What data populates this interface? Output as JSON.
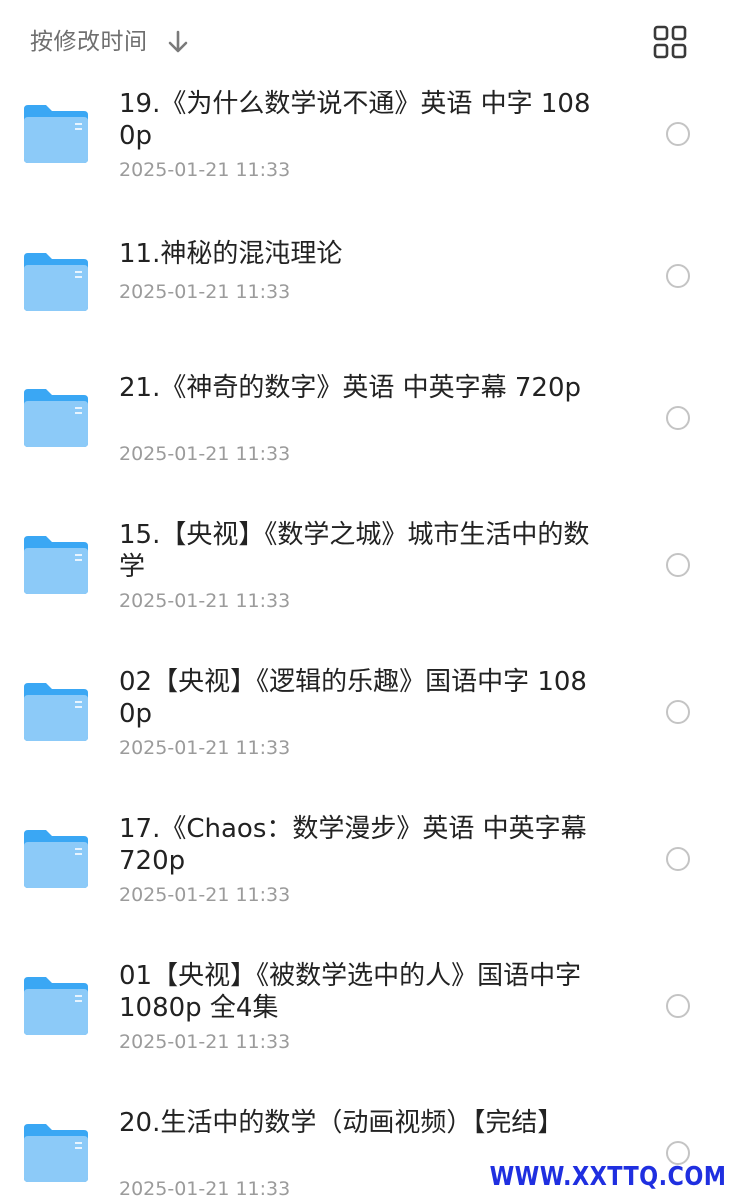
{
  "sort_bar": {
    "label": "按修改时间",
    "arrow_icon": "arrow-down-icon",
    "view_toggle_icon": "grid-view-icon"
  },
  "colors": {
    "folder_back": "#3aa7f4",
    "folder_front": "#8ccaf8",
    "text_primary": "#222222",
    "text_secondary": "#9b9b9b",
    "watermark": "#1f2fe0"
  },
  "files": [
    {
      "name": "19.《为什么数学说不通》英语 中字 1080p",
      "date": "2025-01-21 11:33"
    },
    {
      "name": "11.神秘的混沌理论",
      "date": "2025-01-21 11:33"
    },
    {
      "name": "21.《神奇的数字》英语 中英字幕 720p",
      "date": "2025-01-21 11:33"
    },
    {
      "name": "15.【央视】《数学之城》城市生活中的数学",
      "date": "2025-01-21 11:33"
    },
    {
      "name": "02【央视】《逻辑的乐趣》国语中字 1080p",
      "date": "2025-01-21 11:33"
    },
    {
      "name": "17.《Chaos：数学漫步》英语 中英字幕 720p",
      "date": "2025-01-21 11:33"
    },
    {
      "name": "01【央视】《被数学选中的人》国语中字 1080p 全4集",
      "date": "2025-01-21 11:33"
    },
    {
      "name": "20.生活中的数学（动画视频）【完结】",
      "date": "2025-01-21 11:33"
    }
  ],
  "watermark": "WWW.XXTTQ.COM"
}
